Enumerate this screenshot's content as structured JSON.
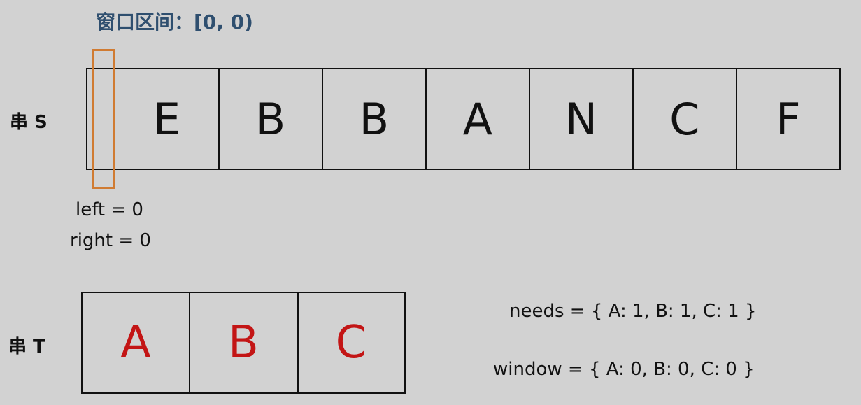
{
  "header": {
    "title": "窗口区间：[0, 0)"
  },
  "string_s": {
    "label": "串 S",
    "chars": [
      "",
      "E",
      "B",
      "B",
      "A",
      "N",
      "C",
      "F"
    ]
  },
  "string_t": {
    "label": "串 T",
    "chars": [
      "A",
      "B",
      "C"
    ]
  },
  "pointers": {
    "left": "left = 0",
    "right": "right = 0"
  },
  "maps": {
    "needs": "needs = { A: 1, B: 1, C: 1 }",
    "window": "window = { A: 0, B: 0, C: 0 }"
  },
  "colors": {
    "background": "#d2d2d2",
    "title": "#2f4f6f",
    "window_box": "#d07b32",
    "t_chars": "#c31515"
  }
}
